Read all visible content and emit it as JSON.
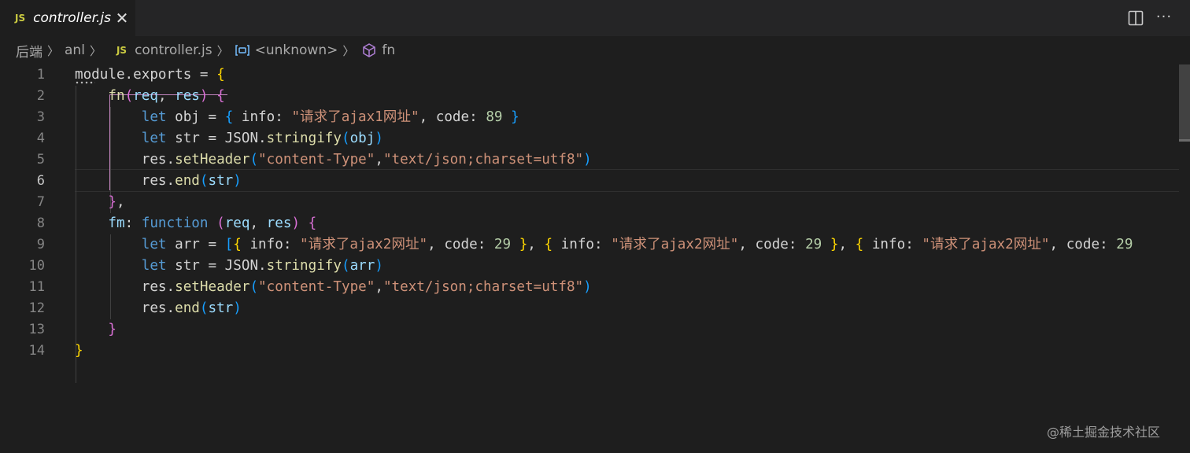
{
  "tab": {
    "badge": "JS",
    "title": "controller.js",
    "close": "✕"
  },
  "toolbar": {
    "more": "···"
  },
  "breadcrumb": {
    "folder1": "后端",
    "folder2": "anl",
    "js_badge": "JS",
    "file": "controller.js",
    "symbol": "<unknown>",
    "method": "fn"
  },
  "editor": {
    "line_numbers": [
      "1",
      "2",
      "3",
      "4",
      "5",
      "6",
      "7",
      "8",
      "9",
      "10",
      "11",
      "12",
      "13",
      "14"
    ],
    "active_line": 6,
    "lines": [
      [
        {
          "t": "module.exports = ",
          "c": "plain"
        },
        {
          "t": "{",
          "c": "b1"
        }
      ],
      [
        {
          "t": "    fn",
          "c": "fn"
        },
        {
          "t": "(",
          "c": "b2"
        },
        {
          "t": "req",
          "c": "var"
        },
        {
          "t": ", ",
          "c": "punc"
        },
        {
          "t": "res",
          "c": "var"
        },
        {
          "t": ")",
          "c": "b2"
        },
        {
          "t": " ",
          "c": "punc"
        },
        {
          "t": "{",
          "c": "b2"
        }
      ],
      [
        {
          "t": "        let",
          "c": "kw"
        },
        {
          "t": " obj = ",
          "c": "plain"
        },
        {
          "t": "{",
          "c": "b3"
        },
        {
          "t": " info: ",
          "c": "plain"
        },
        {
          "t": "\"请求了ajax1网址\"",
          "c": "str"
        },
        {
          "t": ", code: ",
          "c": "plain"
        },
        {
          "t": "89",
          "c": "num"
        },
        {
          "t": " ",
          "c": "plain"
        },
        {
          "t": "}",
          "c": "b3"
        }
      ],
      [
        {
          "t": "        let",
          "c": "kw"
        },
        {
          "t": " str = JSON.",
          "c": "plain"
        },
        {
          "t": "stringify",
          "c": "fn"
        },
        {
          "t": "(",
          "c": "b3"
        },
        {
          "t": "obj",
          "c": "var"
        },
        {
          "t": ")",
          "c": "b3"
        }
      ],
      [
        {
          "t": "        res.",
          "c": "plain"
        },
        {
          "t": "setHeader",
          "c": "fn"
        },
        {
          "t": "(",
          "c": "b3"
        },
        {
          "t": "\"content-Type\"",
          "c": "str"
        },
        {
          "t": ",",
          "c": "punc"
        },
        {
          "t": "\"text/json;charset=utf8\"",
          "c": "str"
        },
        {
          "t": ")",
          "c": "b3"
        }
      ],
      [
        {
          "t": "        res.",
          "c": "plain"
        },
        {
          "t": "end",
          "c": "fn"
        },
        {
          "t": "(",
          "c": "b3"
        },
        {
          "t": "str",
          "c": "var"
        },
        {
          "t": ")",
          "c": "b3"
        }
      ],
      [
        {
          "t": "    ",
          "c": "plain"
        },
        {
          "t": "}",
          "c": "b2"
        },
        {
          "t": ",",
          "c": "punc"
        }
      ],
      [
        {
          "t": "    fm",
          "c": "var"
        },
        {
          "t": ": ",
          "c": "plain"
        },
        {
          "t": "function",
          "c": "kw"
        },
        {
          "t": " ",
          "c": "plain"
        },
        {
          "t": "(",
          "c": "b2"
        },
        {
          "t": "req",
          "c": "var"
        },
        {
          "t": ", ",
          "c": "punc"
        },
        {
          "t": "res",
          "c": "var"
        },
        {
          "t": ")",
          "c": "b2"
        },
        {
          "t": " ",
          "c": "punc"
        },
        {
          "t": "{",
          "c": "b2"
        }
      ],
      [
        {
          "t": "        let",
          "c": "kw"
        },
        {
          "t": " arr = ",
          "c": "plain"
        },
        {
          "t": "[",
          "c": "b3"
        },
        {
          "t": "{",
          "c": "b1"
        },
        {
          "t": " info: ",
          "c": "plain"
        },
        {
          "t": "\"请求了ajax2网址\"",
          "c": "str"
        },
        {
          "t": ", code: ",
          "c": "plain"
        },
        {
          "t": "29",
          "c": "num"
        },
        {
          "t": " ",
          "c": "plain"
        },
        {
          "t": "}",
          "c": "b1"
        },
        {
          "t": ", ",
          "c": "punc"
        },
        {
          "t": "{",
          "c": "b1"
        },
        {
          "t": " info: ",
          "c": "plain"
        },
        {
          "t": "\"请求了ajax2网址\"",
          "c": "str"
        },
        {
          "t": ", code: ",
          "c": "plain"
        },
        {
          "t": "29",
          "c": "num"
        },
        {
          "t": " ",
          "c": "plain"
        },
        {
          "t": "}",
          "c": "b1"
        },
        {
          "t": ", ",
          "c": "punc"
        },
        {
          "t": "{",
          "c": "b1"
        },
        {
          "t": " info: ",
          "c": "plain"
        },
        {
          "t": "\"请求了ajax2网址\"",
          "c": "str"
        },
        {
          "t": ", code: ",
          "c": "plain"
        },
        {
          "t": "29",
          "c": "num"
        }
      ],
      [
        {
          "t": "        let",
          "c": "kw"
        },
        {
          "t": " str = JSON.",
          "c": "plain"
        },
        {
          "t": "stringify",
          "c": "fn"
        },
        {
          "t": "(",
          "c": "b3"
        },
        {
          "t": "arr",
          "c": "var"
        },
        {
          "t": ")",
          "c": "b3"
        }
      ],
      [
        {
          "t": "        res.",
          "c": "plain"
        },
        {
          "t": "setHeader",
          "c": "fn"
        },
        {
          "t": "(",
          "c": "b3"
        },
        {
          "t": "\"content-Type\"",
          "c": "str"
        },
        {
          "t": ",",
          "c": "punc"
        },
        {
          "t": "\"text/json;charset=utf8\"",
          "c": "str"
        },
        {
          "t": ")",
          "c": "b3"
        }
      ],
      [
        {
          "t": "        res.",
          "c": "plain"
        },
        {
          "t": "end",
          "c": "fn"
        },
        {
          "t": "(",
          "c": "b3"
        },
        {
          "t": "str",
          "c": "var"
        },
        {
          "t": ")",
          "c": "b3"
        }
      ],
      [
        {
          "t": "    ",
          "c": "plain"
        },
        {
          "t": "}",
          "c": "b2"
        }
      ],
      [
        {
          "t": "}",
          "c": "b1"
        }
      ]
    ]
  },
  "watermark": "@稀土掘金技术社区"
}
